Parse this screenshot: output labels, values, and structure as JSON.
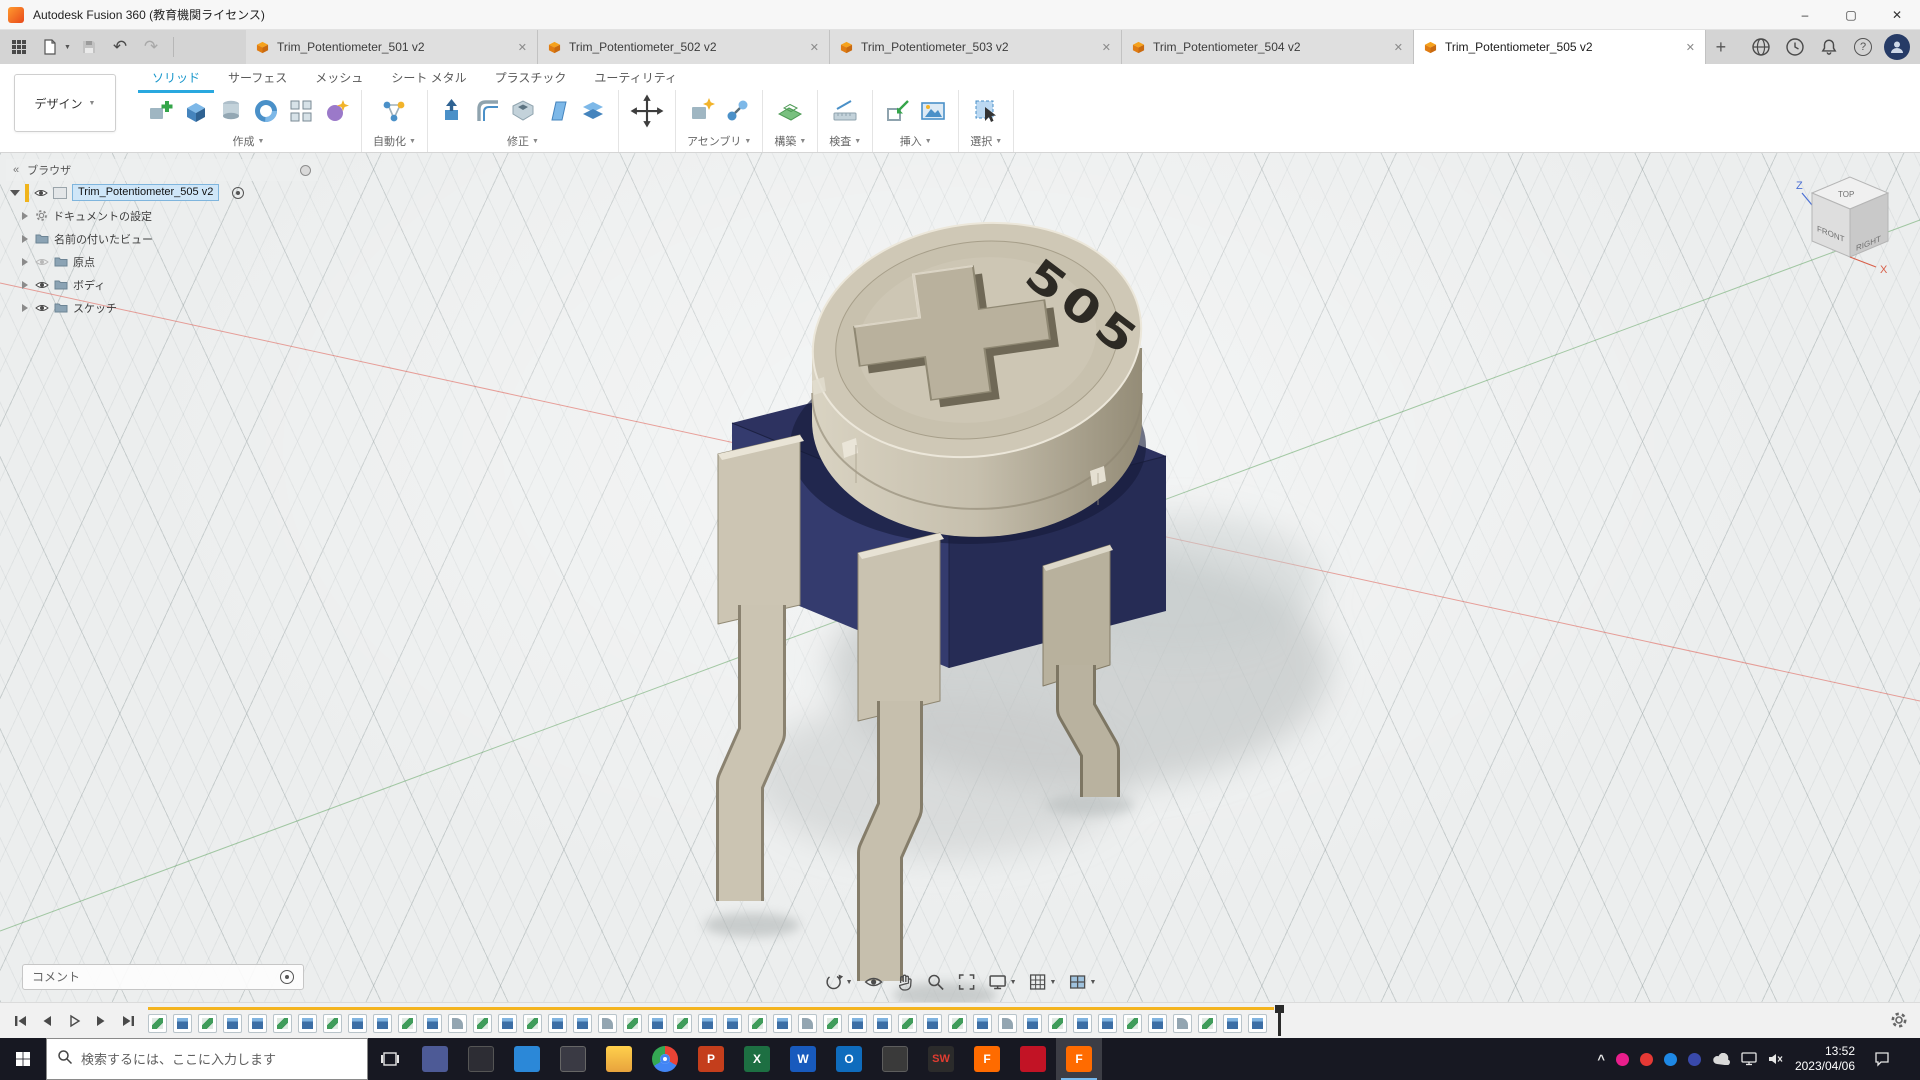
{
  "glyphs": {
    "minimize": "–",
    "maximize": "▢",
    "close": "✕",
    "plus": "+",
    "caret_down": "▼",
    "undo": "↶",
    "redo": "↷",
    "collapse": "«",
    "help": "?",
    "tray_caret": "^"
  },
  "titlebar": {
    "title": "Autodesk Fusion 360 (教育機関ライセンス)"
  },
  "document_tabs": {
    "items": [
      {
        "label": "Trim_Potentiometer_501 v2"
      },
      {
        "label": "Trim_Potentiometer_502 v2"
      },
      {
        "label": "Trim_Potentiometer_503 v2"
      },
      {
        "label": "Trim_Potentiometer_504 v2"
      },
      {
        "label": "Trim_Potentiometer_505 v2"
      }
    ]
  },
  "ribbon": {
    "design_dropdown": "デザイン",
    "env_tabs": [
      {
        "label": "ソリッド"
      },
      {
        "label": "サーフェス"
      },
      {
        "label": "メッシュ"
      },
      {
        "label": "シート メタル"
      },
      {
        "label": "プラスチック"
      },
      {
        "label": "ユーティリティ"
      }
    ],
    "groups": [
      {
        "label": "作成"
      },
      {
        "label": "自動化"
      },
      {
        "label": "修正"
      },
      {
        "label": "アセンブリ"
      },
      {
        "label": "構築"
      },
      {
        "label": "検査"
      },
      {
        "label": "挿入"
      },
      {
        "label": "選択"
      }
    ]
  },
  "browser": {
    "header": "ブラウザ",
    "root_label": "Trim_Potentiometer_505 v2",
    "items": [
      {
        "label": "ドキュメントの設定"
      },
      {
        "label": "名前の付いたビュー"
      },
      {
        "label": "原点"
      },
      {
        "label": "ボディ"
      },
      {
        "label": "スケッチ"
      }
    ]
  },
  "viewcube": {
    "top": "TOP",
    "front": "FRONT",
    "right": "RIGHT",
    "axis_z": "Z",
    "axis_x": "X"
  },
  "model": {
    "marking": "505"
  },
  "comment": {
    "placeholder": "コメント"
  },
  "timeline": {
    "features": [
      "sketch",
      "extrude",
      "sketch",
      "extrude",
      "extrude",
      "sketch",
      "extrude",
      "sketch",
      "extrude",
      "extrude",
      "sketch",
      "extrude",
      "fillet",
      "sketch",
      "extrude",
      "sketch",
      "extrude",
      "extrude",
      "fillet",
      "sketch",
      "extrude",
      "sketch",
      "extrude",
      "extrude",
      "sketch",
      "extrude",
      "fillet",
      "sketch",
      "extrude",
      "extrude",
      "sketch",
      "extrude",
      "sketch",
      "extrude",
      "fillet",
      "extrude",
      "sketch",
      "extrude",
      "extrude",
      "sketch",
      "extrude",
      "fillet",
      "sketch",
      "extrude",
      "extrude"
    ]
  },
  "taskbar": {
    "search_placeholder": "検索するには、ここに入力します",
    "apps": [
      {
        "name": "photos",
        "label": ""
      },
      {
        "name": "terminal",
        "label": ""
      },
      {
        "name": "mail",
        "label": ""
      },
      {
        "name": "media",
        "label": ""
      },
      {
        "name": "explorer",
        "label": ""
      },
      {
        "name": "chrome",
        "label": ""
      },
      {
        "name": "powerpoint",
        "label": "P"
      },
      {
        "name": "excel",
        "label": "X"
      },
      {
        "name": "word",
        "label": "W"
      },
      {
        "name": "outlook",
        "label": "O"
      },
      {
        "name": "tools",
        "label": ""
      },
      {
        "name": "solidworks",
        "label": "SW"
      },
      {
        "name": "fusion-file",
        "label": "F"
      },
      {
        "name": "cad",
        "label": ""
      },
      {
        "name": "fusion",
        "label": "F",
        "active": true
      }
    ],
    "clock": {
      "time": "13:52",
      "date": "2023/04/06"
    }
  }
}
